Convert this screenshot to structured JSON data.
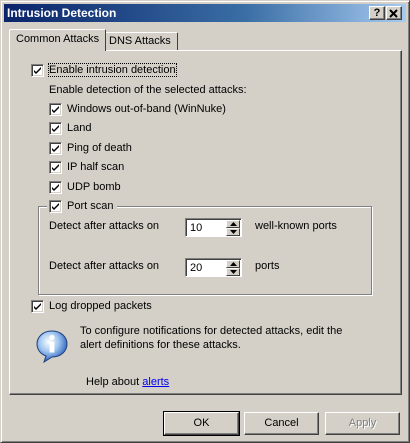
{
  "window": {
    "title": "Intrusion Detection",
    "help_button": "?",
    "close_button": "×"
  },
  "tabs": [
    {
      "label": "Common Attacks",
      "active": true
    },
    {
      "label": "DNS Attacks",
      "active": false
    }
  ],
  "enable_intrusion": {
    "label": "Enable intrusion detection",
    "checked": true
  },
  "section_label": "Enable detection of the selected attacks:",
  "attacks": [
    {
      "label": "Windows out-of-band (WinNuke)",
      "checked": true
    },
    {
      "label": "Land",
      "checked": true
    },
    {
      "label": "Ping of death",
      "checked": true
    },
    {
      "label": "IP half scan",
      "checked": true
    },
    {
      "label": "UDP bomb",
      "checked": true
    }
  ],
  "port_scan": {
    "label": "Port scan",
    "checked": true,
    "row1": {
      "label": "Detect after attacks on",
      "value": "10",
      "suffix": "well-known ports"
    },
    "row2": {
      "label": "Detect after attacks on",
      "value": "20",
      "suffix": "ports"
    }
  },
  "log_dropped": {
    "label": "Log dropped packets",
    "checked": true
  },
  "info": {
    "icon": "info-icon",
    "line1": "To configure notifications for detected attacks, edit the",
    "line2": "alert definitions for these attacks."
  },
  "help": {
    "prefix": "Help about",
    "link": "alerts"
  },
  "buttons": {
    "ok": "OK",
    "cancel": "Cancel",
    "apply": "Apply"
  }
}
